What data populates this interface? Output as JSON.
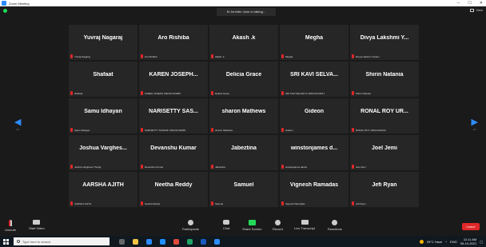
{
  "window": {
    "title": "Zoom Meeting"
  },
  "meeting": {
    "talking": "M Jennifer Jane is talking...",
    "view_label": "View",
    "page_left": "1/7",
    "page_right": "1/7",
    "participants_count": "35"
  },
  "tiles": [
    {
      "display": "Yuvraj Nagaraj",
      "sub": "Yuvraj Nagaraj"
    },
    {
      "display": "Aro Rishiba",
      "sub": "Aro Rishiba"
    },
    {
      "display": "Akash .k",
      "sub": "Akash .k"
    },
    {
      "display": "Megha",
      "sub": "Megha"
    },
    {
      "display": "Divya Lakshmi Y...",
      "sub": "Divya Lakshmi Yanam"
    },
    {
      "display": "Shafaat",
      "sub": "Shafaat"
    },
    {
      "display": "KAREN JOSEPH...",
      "sub": "KAREN JOSEPH URK21CO3009"
    },
    {
      "display": "Delicia Grace",
      "sub": "Delicia Grace"
    },
    {
      "display": "SRI KAVI SELVA...",
      "sub": "SRI KAVI SELVAN S URK21CO3017"
    },
    {
      "display": "Shirin Natania",
      "sub": "Shirin Natania"
    },
    {
      "display": "Samu Idhayan",
      "sub": "Samu Idhayan"
    },
    {
      "display": "NARISETTY SAS...",
      "sub": "NARISETTY SASANK URK21CS2065"
    },
    {
      "display": "sharon Mathews",
      "sub": "sharon Mathews"
    },
    {
      "display": "Gideon",
      "sub": "Gideon"
    },
    {
      "display": "RONAL ROY UR...",
      "sub": "RONAL ROY URK21IA1034"
    },
    {
      "display": "Joshua Varghes...",
      "sub": "Joshua Varghese Thoraji"
    },
    {
      "display": "Devanshu Kumar",
      "sub": "Devanshu Kumar"
    },
    {
      "display": "Jabeztina",
      "sub": "Jabeztina"
    },
    {
      "display": "winstonjames d...",
      "sub": "winstonjames daniel"
    },
    {
      "display": "Joel Jemi",
      "sub": "Joel Jemi"
    },
    {
      "display": "AARSHA AJITH",
      "sub": "AARSHA AJITH"
    },
    {
      "display": "Neetha Reddy",
      "sub": "Neetha Reddy"
    },
    {
      "display": "Samuel",
      "sub": "Samuel"
    },
    {
      "display": "Vignesh Ramadas",
      "sub": "Vignesh Ramadas"
    },
    {
      "display": "Jefi Ryan",
      "sub": "Jefi Ryan"
    }
  ],
  "toolbar": {
    "unmute": "Unmute",
    "start_video": "Start Video",
    "participants": "Participants",
    "chat": "Chat",
    "share_screen": "Share Screen",
    "record": "Record",
    "live_transcript": "Live Transcript",
    "reactions": "Reactions",
    "leave": "Leave"
  },
  "taskbar": {
    "search_placeholder": "Type here to search",
    "weather": "29°C Haze",
    "lang": "ENG",
    "time": "11:11 AM",
    "date": "05-10-2021"
  },
  "colors": {
    "accent": "#2d8cff",
    "leave": "#e02828",
    "share": "#23d959",
    "tile_bg": "#262626"
  }
}
